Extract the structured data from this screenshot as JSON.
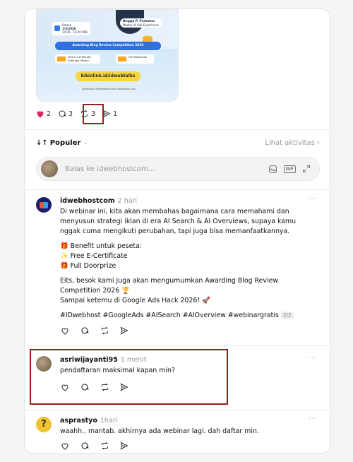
{
  "media": {
    "speaker_name": "Angga P. Pratama",
    "speaker_role": "Master of Ads Experience",
    "date_day": "Selasa",
    "date_value": "1/5/2026",
    "date_time": "14.00 - 16.00 WIB",
    "banner": "Awarding Blog Review Competition 2026",
    "pill1": "Free E-Certificate Softcopy Materi",
    "pill2": "Full Doorprize",
    "link": "bikinlink.id/idwebtalks",
    "footer": "idwebhost   @idwebhostcom   idwebhost.com"
  },
  "stats": {
    "likes": "2",
    "comments": "3",
    "reposts": "3",
    "shares": "1"
  },
  "sort": {
    "label": "Populer",
    "activity": "Lihat aktivitas"
  },
  "reply": {
    "placeholder": "Balas ke idwebhostcom...",
    "gif": "GIF"
  },
  "posts": [
    {
      "user": "idwebhostcom",
      "time": "2 hari",
      "paragraphs": [
        "Di webinar ini, kita akan membahas bagaimana cara memahami dan menyusun strategi iklan di era AI Search & AI Overviews, supaya kamu nggak cuma mengikuti perubahan, tapi juga bisa memanfaatkannya.",
        "🎁 Benefit untuk peseta:",
        "✨ Free E-Certificate",
        "🎁 Full Doorprize",
        "Eits, besok kami juga akan mengumumkan Awarding Blog Review Competition 2026 🏆",
        "Sampai ketemu di Google Ads Hack 2026! 🚀",
        "#IDwebhost #GoogleAds #AISearch #AIOverview #webinargratis"
      ],
      "page_count": "2/2"
    },
    {
      "user": "asriwijayanti95",
      "time": "1 menit",
      "text": "pendaftaran maksimal kapan min?"
    },
    {
      "user": "asprastyo",
      "time": "1hari",
      "text": "waahh.. mantab. akhirnya ada webinar lagi. dah daftar min."
    }
  ],
  "more_label": "···",
  "colors": {
    "like": "#e0245e",
    "highlight": "#9b1c1c"
  }
}
